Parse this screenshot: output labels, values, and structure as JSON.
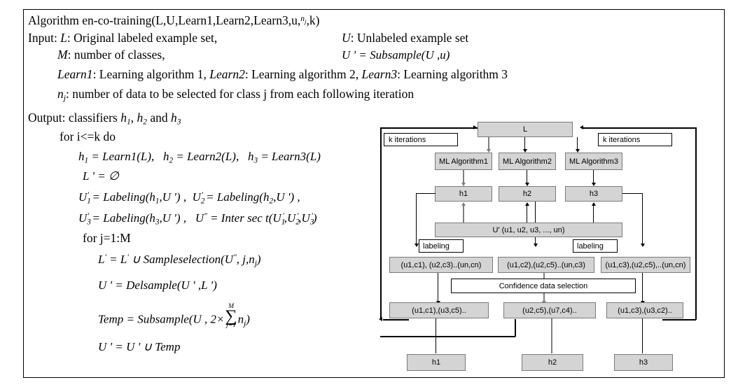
{
  "algorithm": {
    "title_prefix": "Algorithm en-co-training(L,U,Learn1,Learn2,Learn3,u,",
    "title_sub_var": "n",
    "title_sub_idx": "j",
    "title_suffix": ",k)",
    "input_label": "Input:",
    "input_L_var": "L",
    "input_L_text": ": Original labeled example set,",
    "input_U_var": "U",
    "input_U_text": ": Unlabeled example set",
    "input_M_var": "M",
    "input_M_text": ": number of classes,",
    "subsample_eq": "U ' = Subsample(U ,u)",
    "learn1_var": "Learn1",
    "learn1_text": ": Learning algorithm 1,",
    "learn2_var": "Learn2",
    "learn2_text": ": Learning algorithm 2,",
    "learn3_var": "Learn3",
    "learn3_text": ": Learning algorithm 3",
    "nj_var": "n",
    "nj_idx": "j",
    "nj_text": ": number of data to be selected for class j from each following iteration",
    "output_label": "Output: classifiers",
    "output_h1": "h",
    "output_h1_idx": "1",
    "output_comma": ",",
    "output_h2": "h",
    "output_h2_idx": "2",
    "output_and": "and",
    "output_h3": "h",
    "output_h3_idx": "3",
    "for_i": "for i<=k do",
    "eq_h1": "h",
    "eq_h1_idx": "1",
    "eq_h1_rhs": "= Learn1(L)",
    "eq_h2": "h",
    "eq_h2_idx": "2",
    "eq_h2_rhs": "= Learn2(L)",
    "eq_h3": "h",
    "eq_h3_idx": "3",
    "eq_h3_rhs": "= Learn3(L)",
    "eq_Lprime_empty": "L ' = ∅",
    "eq_U1": "U",
    "eq_U1_idx": "1",
    "eq_U1_rhs": "= Labeling(h",
    "eq_U1_hidx": "1",
    "eq_U1_tail": ",U ') ,",
    "eq_U2": "U",
    "eq_U2_idx": "2",
    "eq_U2_rhs": "= Labeling(h",
    "eq_U2_hidx": "2",
    "eq_U2_tail": ",U ') ,",
    "eq_U3": "U",
    "eq_U3_idx": "3",
    "eq_U3_rhs": "= Labeling(h",
    "eq_U3_hidx": "3",
    "eq_U3_tail": ",U ') ,",
    "eq_Udd": "U",
    "eq_Udd_rhs": "= Inter sec t(U",
    "eq_Udd_i1": "1",
    "eq_Udd_c1": ",U",
    "eq_Udd_i2": "2",
    "eq_Udd_c2": ",U",
    "eq_Udd_i3": "3",
    "eq_Udd_close": ")",
    "for_j": "for j=1:M",
    "eq_sampsel_lhs": "L",
    "eq_sampsel_rhs": "= L",
    "eq_sampsel_tail": "∪ Sampleselection(U",
    "eq_sampsel_args": ", j,n",
    "eq_sampsel_njidx": "j",
    "eq_sampsel_close": ")",
    "eq_delsample": "U ' = Delsample(U ' ,L ')",
    "eq_temp_lhs": "Temp = Subsample(U , 2×",
    "eq_temp_sum_top": "M",
    "eq_temp_sum_bot": "j=1",
    "eq_temp_n": "n",
    "eq_temp_nidx": "j",
    "eq_temp_close": ")",
    "eq_uprime_union": "U ' = U ' ∪ Temp"
  },
  "flowchart": {
    "k_iterations_left": "k iterations",
    "k_iterations_right": "k iterations",
    "L": "L",
    "ml1": "ML Algorithm1",
    "ml2": "ML Algorithm2",
    "ml3": "ML Algorithm3",
    "h1_top": "h1",
    "h2_top": "h2",
    "h3_top": "h3",
    "u_prime": "U' (u1, u2, u3, ..., un)",
    "labeling_left": "labeling",
    "labeling_right": "labeling",
    "labeled1": "(u1,c1), (u2,c3)..(un,cn)",
    "labeled2": "(u1,c2),(u2,c5)..(un,c3)",
    "labeled3": "(u1,c3),(u2,c5),..(un,cn)",
    "confidence": "Confidence data selection",
    "selected1": "(u1,c1),(u3,c5)..",
    "selected2": "(u2,c5),(u7,c4)..",
    "selected3": "(u1,c3),(u3,c2)..",
    "h1_bottom": "h1",
    "h2_bottom": "h2",
    "h3_bottom": "h3",
    "colors": {
      "node_fill": "#d4d4d4",
      "node_border": "#7a7a7a",
      "plain_fill": "#ffffff",
      "line": "#000000",
      "grey_line": "#7e7e7e"
    }
  }
}
